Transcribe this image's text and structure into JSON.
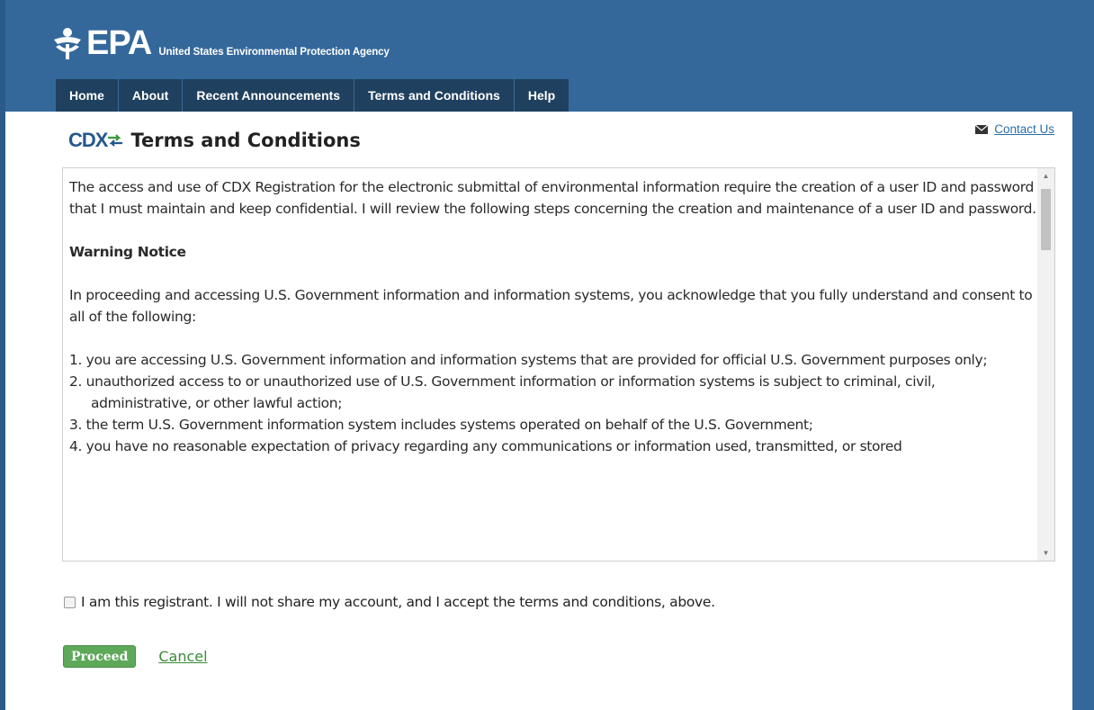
{
  "header": {
    "logo_text": "EPA",
    "agency_name": "United States Environmental Protection Agency"
  },
  "nav": {
    "items": [
      {
        "label": "Home"
      },
      {
        "label": "About"
      },
      {
        "label": "Recent Announcements"
      },
      {
        "label": "Terms and Conditions"
      },
      {
        "label": "Help"
      }
    ]
  },
  "contact": {
    "label": "Contact Us",
    "icon": "envelope-icon"
  },
  "page": {
    "cdx_logo": "CDX",
    "title": "Terms and Conditions"
  },
  "terms": {
    "intro": "The access and use of CDX Registration for the electronic submittal of environmental information require the creation of a user ID and password that I must maintain and keep confidential. I will review the following steps concerning the creation and maintenance of a user ID and password.",
    "warning_heading": "Warning Notice",
    "warning_intro": "In proceeding and accessing U.S. Government information and information systems, you acknowledge that you fully understand and consent to all of the following:",
    "items": [
      "1. you are accessing U.S. Government information and information systems that are provided for official U.S. Government purposes only;",
      "2. unauthorized access to or unauthorized use of U.S. Government information or information systems is subject to criminal, civil, administrative, or other lawful action;",
      "3. the term U.S. Government information system includes systems operated on behalf of the U.S. Government;",
      "4. you have no reasonable expectation of privacy regarding any communications or information used, transmitted, or stored"
    ]
  },
  "accept": {
    "label": "I am this registrant. I will not share my account, and I accept the terms and conditions, above.",
    "checked": false
  },
  "actions": {
    "proceed_label": "Proceed",
    "cancel_label": "Cancel"
  },
  "colors": {
    "header_blue": "#34689b",
    "nav_dark": "#20405f",
    "proceed_green": "#5ea85a",
    "link_blue": "#2a6faa"
  }
}
